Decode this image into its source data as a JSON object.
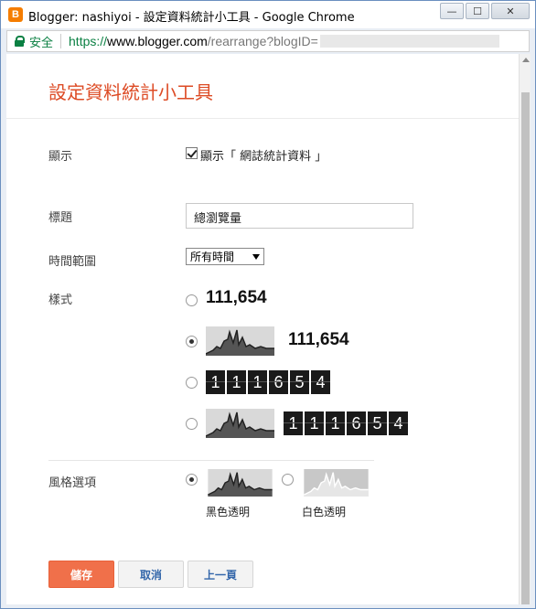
{
  "window": {
    "title": "Blogger: nashiyoi - 設定資料統計小工具 - Google Chrome",
    "app_icon_letter": "B",
    "minimize_glyph": "—",
    "maximize_glyph": "☐",
    "close_glyph": "✕"
  },
  "addressbar": {
    "secure_label": "安全",
    "url_https": "https://",
    "url_host": "www.blogger.com",
    "url_path": "/rearrange?blogID="
  },
  "page": {
    "title": "設定資料統計小工具"
  },
  "form": {
    "display_label": "顯示",
    "display_checkbox_label": "顯示「 網誌統計資料 」",
    "display_checked": true,
    "title_label": "標題",
    "title_value": "總瀏覽量",
    "time_range_label": "時間範圍",
    "time_range_value": "所有時間",
    "style_label": "樣式",
    "style_options": [
      {
        "number": "111,654",
        "checked": false
      },
      {
        "number": "111,654",
        "checked": true
      },
      {
        "digits": [
          "1",
          "1",
          "1",
          "6",
          "5",
          "4"
        ],
        "checked": false
      },
      {
        "digits": [
          "1",
          "1",
          "1",
          "6",
          "5",
          "4"
        ],
        "checked": false
      }
    ],
    "theme_label": "風格選項",
    "theme_dark_label": "黑色透明",
    "theme_light_label": "白色透明",
    "theme_dark_checked": true
  },
  "buttons": {
    "save": "儲存",
    "cancel": "取消",
    "back": "上一頁"
  },
  "colors": {
    "accent": "#dd4b25",
    "save_button": "#f0704a",
    "secure_green": "#0b8043"
  }
}
